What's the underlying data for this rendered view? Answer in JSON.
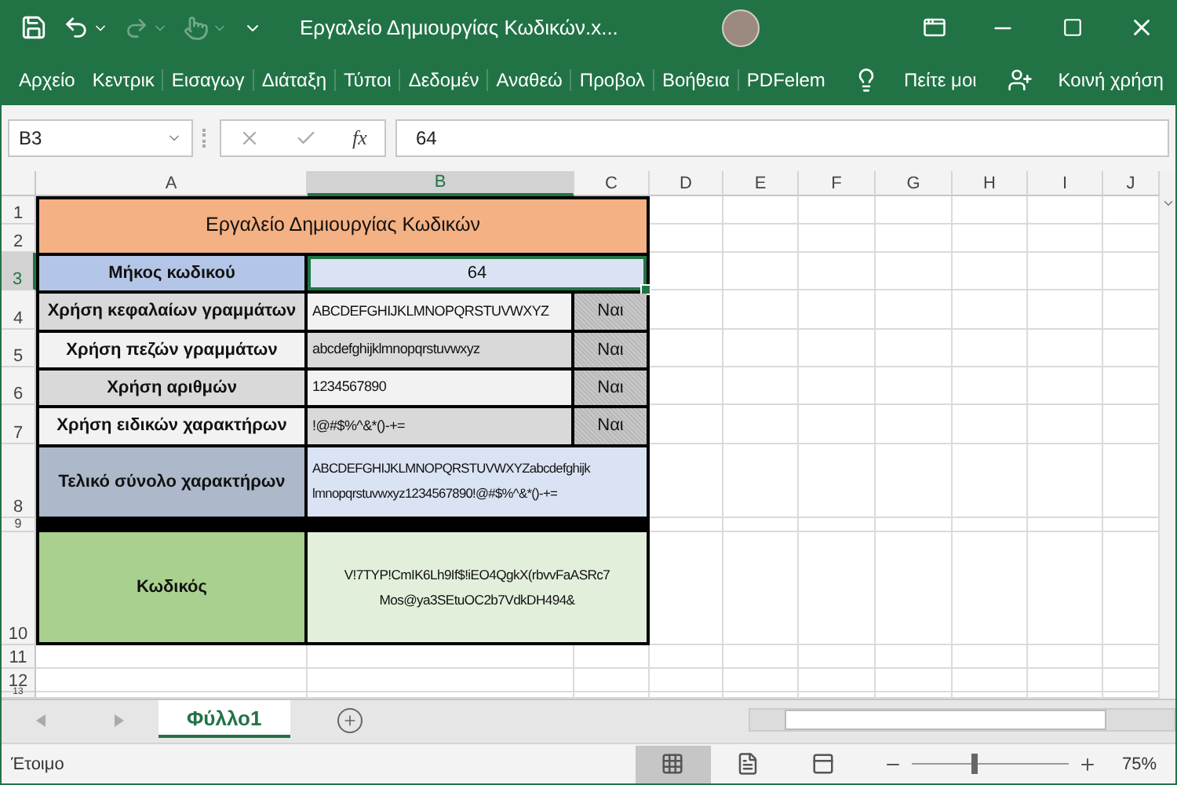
{
  "window": {
    "title": "Εργαλείο Δημιουργίας Κωδικών.x..."
  },
  "ribbon_tabs": [
    {
      "label": "Αρχείο",
      "selected": false
    },
    {
      "label": "Κεντρικ",
      "selected": false
    },
    {
      "label": "Εισαγωγ",
      "selected": false
    },
    {
      "label": "Διάταξη",
      "selected": false
    },
    {
      "label": "Τύποι",
      "selected": false
    },
    {
      "label": "Δεδομέν",
      "selected": false
    },
    {
      "label": "Αναθεώ",
      "selected": false
    },
    {
      "label": "Προβολ",
      "selected": false
    },
    {
      "label": "Βοήθεια",
      "selected": false
    },
    {
      "label": "PDFelem",
      "selected": false
    }
  ],
  "tell_me": "Πείτε μοι",
  "share": "Κοινή χρήση",
  "name_box": "B3",
  "function_label": "fx",
  "formula": "64",
  "columns": [
    {
      "label": "A",
      "selected": false
    },
    {
      "label": "B",
      "selected": true
    },
    {
      "label": "C",
      "selected": false
    },
    {
      "label": "D",
      "selected": false
    },
    {
      "label": "E",
      "selected": false
    },
    {
      "label": "F",
      "selected": false
    },
    {
      "label": "G",
      "selected": false
    },
    {
      "label": "H",
      "selected": false
    },
    {
      "label": "I",
      "selected": false
    },
    {
      "label": "J",
      "selected": false
    }
  ],
  "rows": [
    {
      "label": "1",
      "selected": false
    },
    {
      "label": "2",
      "selected": false
    },
    {
      "label": "3",
      "selected": true
    },
    {
      "label": "4",
      "selected": false
    },
    {
      "label": "5",
      "selected": false
    },
    {
      "label": "6",
      "selected": false
    },
    {
      "label": "7",
      "selected": false
    },
    {
      "label": "8",
      "selected": false
    },
    {
      "label": "9",
      "selected": false
    },
    {
      "label": "10",
      "selected": false
    },
    {
      "label": "11",
      "selected": false
    },
    {
      "label": "12",
      "selected": false
    },
    {
      "label": "13",
      "selected": false
    }
  ],
  "sheet": {
    "title": "Εργαλείο Δημιουργίας Κωδικών",
    "length": {
      "label": "Μήκος κωδικού",
      "value": "64",
      "selected": true
    },
    "options": [
      {
        "label": "Χρήση κεφαλαίων γραμμάτων",
        "chars": "ABCDEFGHIJKLMNOPQRSTUVWXYZ",
        "flag": "Ναι"
      },
      {
        "label": "Χρήση πεζών γραμμάτων",
        "chars": "abcdefghijklmnopqrstuvwxyz",
        "flag": "Ναι"
      },
      {
        "label": "Χρήση αριθμών",
        "chars": "1234567890",
        "flag": "Ναι"
      },
      {
        "label": "Χρήση ειδικών χαρακτήρων",
        "chars": "!@#$%^&*()-+=",
        "flag": "Ναι"
      }
    ],
    "charset": {
      "label": "Τελικό σύνολο χαρακτήρων",
      "lines": [
        "ABCDEFGHIJKLMNOPQRSTUVWXYZabcdefghijk",
        "lmnopqrstuvwxyz1234567890!@#$%^&*()-+="
      ]
    },
    "password": {
      "label": "Κωδικός",
      "lines": [
        "V!7TYP!CmIK6Lh9If$!iEO4QgkX(rbvvFaASRc7",
        "Mos@ya3SEtuOC2b7VdkDH494&"
      ]
    }
  },
  "sheet_tabs": [
    {
      "label": "Φύλλο1",
      "selected": true
    }
  ],
  "status": "Έτοιμο",
  "views": [
    {
      "kind": "normal",
      "selected": true
    },
    {
      "kind": "page_layout",
      "selected": false
    },
    {
      "kind": "page_break",
      "selected": false
    }
  ],
  "zoom": {
    "level": 0.38,
    "label": "75%"
  }
}
